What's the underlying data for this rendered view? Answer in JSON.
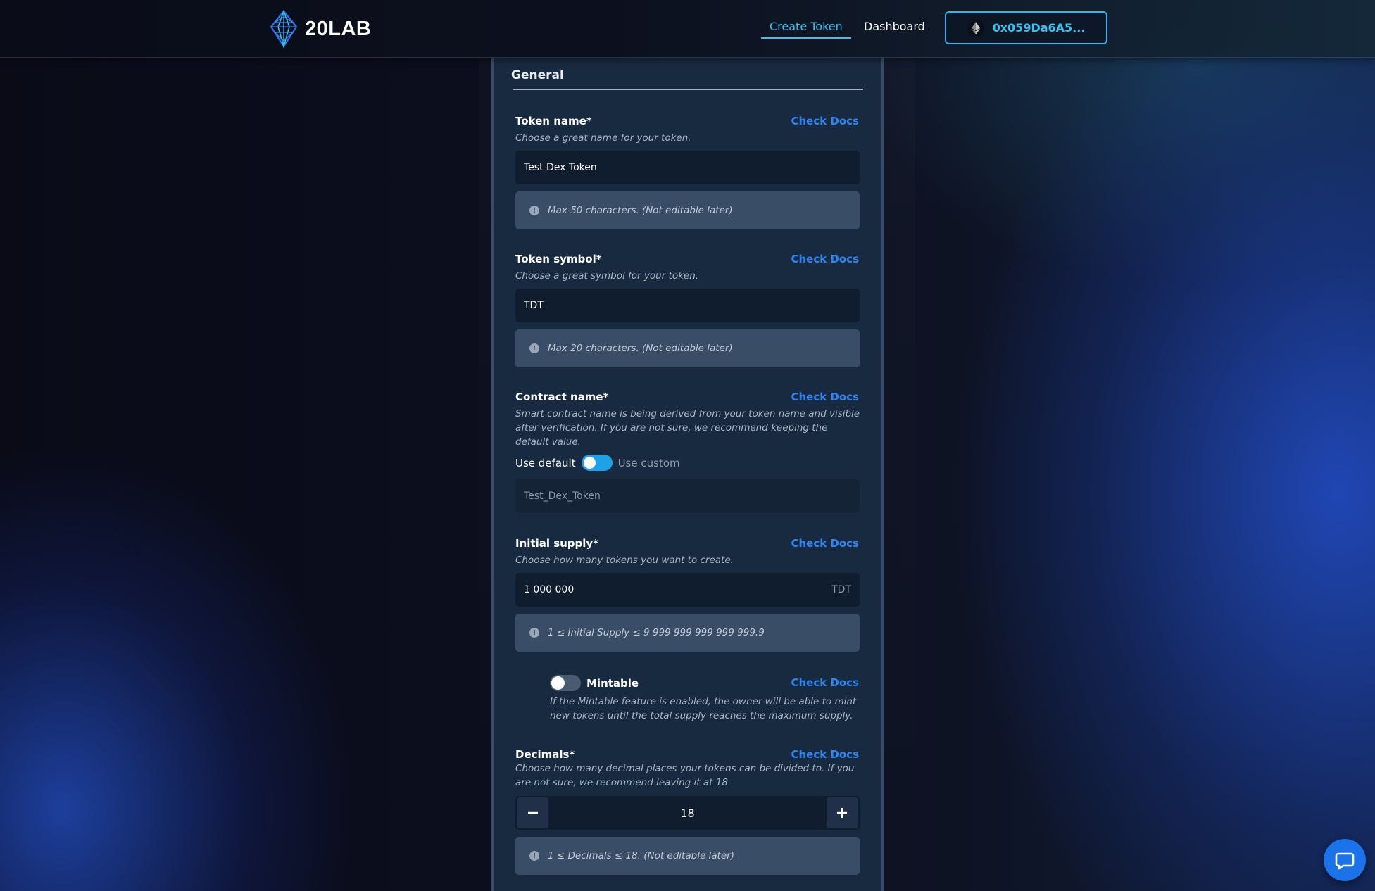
{
  "header": {
    "logo_text": "20LAB",
    "nav": [
      {
        "label": "Create Token",
        "active": true
      },
      {
        "label": "Dashboard",
        "active": false
      }
    ],
    "wallet_address": "0x059Da6A5..."
  },
  "form": {
    "section_title": "General",
    "check_docs_label": "Check Docs",
    "token_name": {
      "label": "Token name*",
      "helper": "Choose a great name for your token.",
      "value": "Test Dex Token",
      "info": "Max 50 characters. (Not editable later)"
    },
    "token_symbol": {
      "label": "Token symbol*",
      "helper": "Choose a great symbol for your token.",
      "value": "TDT",
      "info": "Max 20 characters. (Not editable later)"
    },
    "contract_name": {
      "label": "Contract name*",
      "helper": "Smart contract name is being derived from your token name and visible after verification. If you are not sure, we recommend keeping the default value.",
      "toggle_left": "Use default",
      "toggle_right": "Use custom",
      "value": "Test_Dex_Token"
    },
    "initial_supply": {
      "label": "Initial supply*",
      "helper": "Choose how many tokens you want to create.",
      "value": "1 000 000",
      "suffix": "TDT",
      "info": "1 ≤ Initial Supply ≤ 9 999 999 999 999 999.9"
    },
    "mintable": {
      "label": "Mintable",
      "enabled": false,
      "helper": "If the Mintable feature is enabled, the owner will be able to mint new tokens until the total supply reaches the maximum supply."
    },
    "decimals": {
      "label": "Decimals*",
      "helper": "Choose how many decimal places your tokens can be divided to. If you are not sure, we recommend leaving it at 18.",
      "value": "18",
      "info": "1 ≤ Decimals ≤ 18. (Not editable later)"
    }
  },
  "icons": {
    "logo": "diamond-logo-icon",
    "wallet": "ethereum-icon",
    "info": "info-circle-icon",
    "minus": "minus-icon",
    "plus": "plus-icon",
    "chat": "chat-support-icon"
  },
  "colors": {
    "accent": "#35c4ee",
    "link": "#2f86f0",
    "panel": "#182a40",
    "toggle_on": "#1da2e8"
  }
}
